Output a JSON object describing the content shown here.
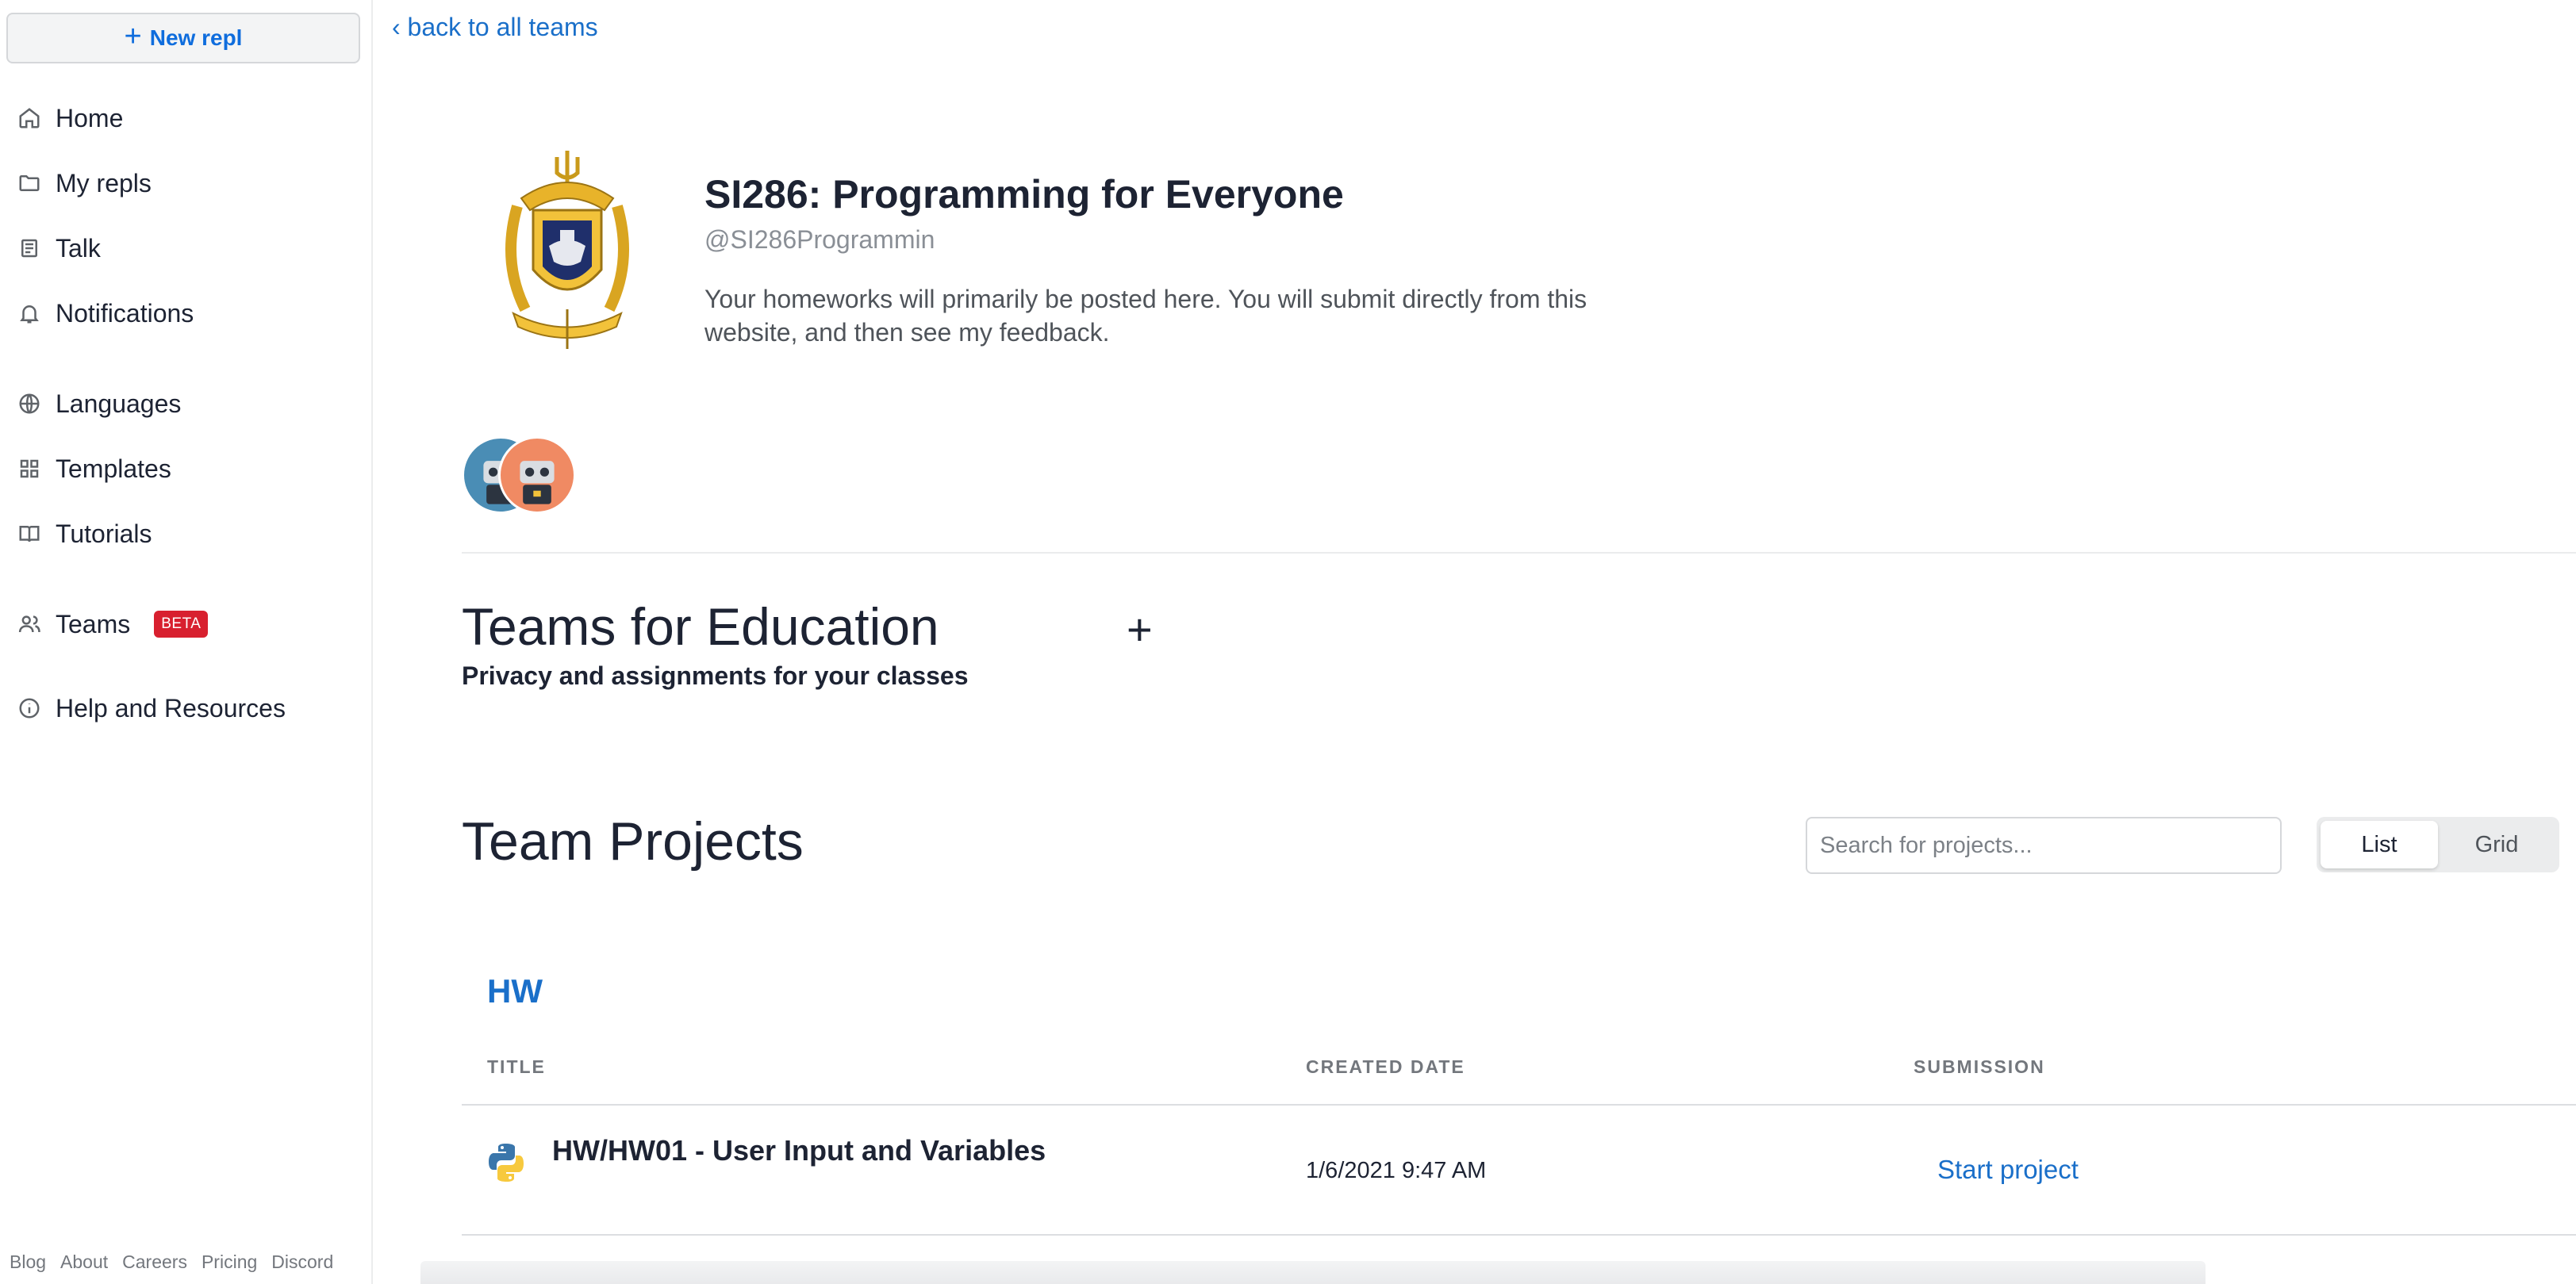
{
  "sidebar": {
    "new_repl_label": "New repl",
    "items": [
      {
        "label": "Home",
        "icon": "home-icon"
      },
      {
        "label": "My repls",
        "icon": "folder-icon"
      },
      {
        "label": "Talk",
        "icon": "talk-icon"
      },
      {
        "label": "Notifications",
        "icon": "bell-icon"
      },
      {
        "label": "Languages",
        "icon": "globe-icon"
      },
      {
        "label": "Templates",
        "icon": "templates-icon"
      },
      {
        "label": "Tutorials",
        "icon": "book-icon"
      },
      {
        "label": "Teams",
        "icon": "users-icon",
        "badge": "BETA"
      },
      {
        "label": "Help and Resources",
        "icon": "info-icon"
      }
    ],
    "footer": [
      "Blog",
      "About",
      "Careers",
      "Pricing",
      "Discord"
    ]
  },
  "main": {
    "back_link": "‹ back to all teams",
    "team": {
      "title": "SI286: Programming for Everyone",
      "handle": "@SI286Programmin",
      "description": "Your homeworks will primarily be posted here. You will submit directly from this website, and then see my feedback."
    },
    "education": {
      "title": "Teams for Education",
      "subtitle": "Privacy and assignments for your classes",
      "add_label": "+"
    },
    "projects": {
      "title": "Team Projects",
      "search_placeholder": "Search for projects...",
      "view_options": [
        "List",
        "Grid"
      ],
      "active_view": "List",
      "group": "HW",
      "columns": [
        "TITLE",
        "CREATED DATE",
        "SUBMISSION"
      ],
      "rows": [
        {
          "title": "HW/HW01 - User Input and Variables",
          "created": "1/6/2021 9:47 AM",
          "action": "Start project"
        }
      ]
    }
  },
  "colors": {
    "accent": "#1a6fc9",
    "badge": "#d8202f",
    "avatar_blue": "#4a8db5",
    "avatar_orange": "#f08a63"
  }
}
